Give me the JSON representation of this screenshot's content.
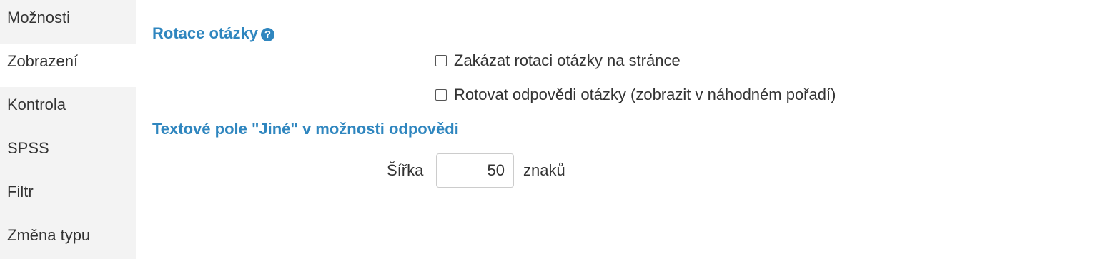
{
  "sidebar": {
    "items": [
      {
        "label": "Možnosti"
      },
      {
        "label": "Zobrazení",
        "active": true
      },
      {
        "label": "Kontrola"
      },
      {
        "label": "SPSS"
      },
      {
        "label": "Filtr"
      },
      {
        "label": "Změna typu"
      }
    ]
  },
  "rotation": {
    "title": "Rotace otázky",
    "help_icon": "question-circle-icon",
    "options": [
      {
        "label": "Zakázat rotaci otázky na stránce",
        "checked": false
      },
      {
        "label": "Rotovat odpovědi otázky (zobrazit v náhodném pořadí)",
        "checked": false
      }
    ]
  },
  "other_field": {
    "title": "Textové pole \"Jiné\" v možnosti odpovědi",
    "width_label": "Šířka",
    "width_value": "50",
    "unit": "znaků"
  },
  "colors": {
    "accent": "#2f86bf",
    "sidebar_bg": "#f3f3f3",
    "text": "#333333"
  }
}
